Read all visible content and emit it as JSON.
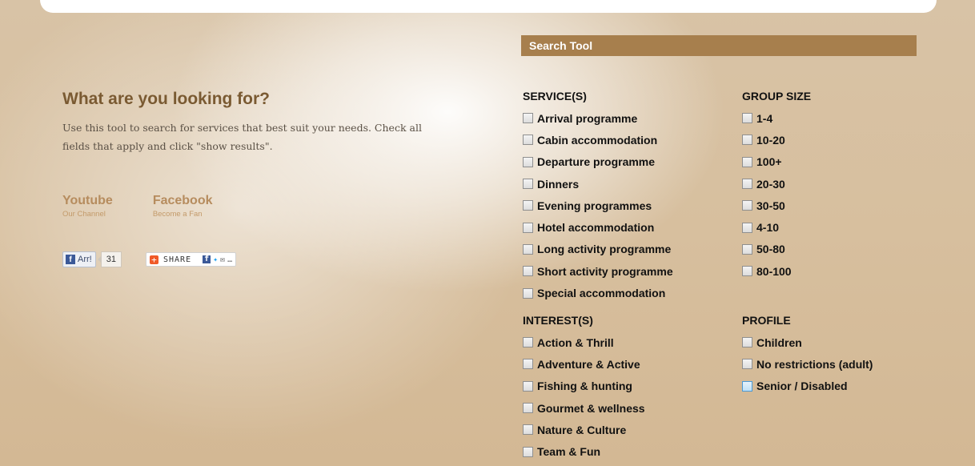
{
  "left": {
    "heading": "What are you looking for?",
    "intro": "Use this tool to search for services that best suit your needs. Check all fields that apply and click \"show results\".",
    "social": [
      {
        "title": "Youtube",
        "sub": "Our Channel"
      },
      {
        "title": "Facebook",
        "sub": "Become a Fan"
      }
    ],
    "fb_button": {
      "label": "Arr!",
      "count": "31"
    },
    "share_button": {
      "label": "SHARE"
    }
  },
  "search": {
    "header": "Search Tool",
    "services": {
      "title": "SERVICE(S)",
      "options": [
        "Arrival programme",
        "Cabin accommodation",
        "Departure programme",
        "Dinners",
        "Evening programmes",
        "Hotel accommodation",
        "Long activity programme",
        "Short activity programme",
        "Special accommodation"
      ]
    },
    "group_size": {
      "title": "GROUP SIZE",
      "options": [
        "1-4",
        "10-20",
        "100+",
        "20-30",
        "30-50",
        "4-10",
        "50-80",
        "80-100"
      ]
    },
    "interests": {
      "title": "INTEREST(S)",
      "options": [
        "Action & Thrill",
        "Adventure & Active",
        "Fishing & hunting",
        "Gourmet & wellness",
        "Nature & Culture",
        "Team & Fun"
      ]
    },
    "profile": {
      "title": "PROFILE",
      "options": [
        "Children",
        "No restrictions (adult)",
        "Senior / Disabled"
      ]
    }
  },
  "colors": {
    "accent": "#a77f4d",
    "heading": "#7a5a32",
    "social_link": "#b68c5e"
  },
  "icons": [
    "facebook-icon",
    "addthis-plus-icon",
    "twitter-icon",
    "email-icon"
  ]
}
